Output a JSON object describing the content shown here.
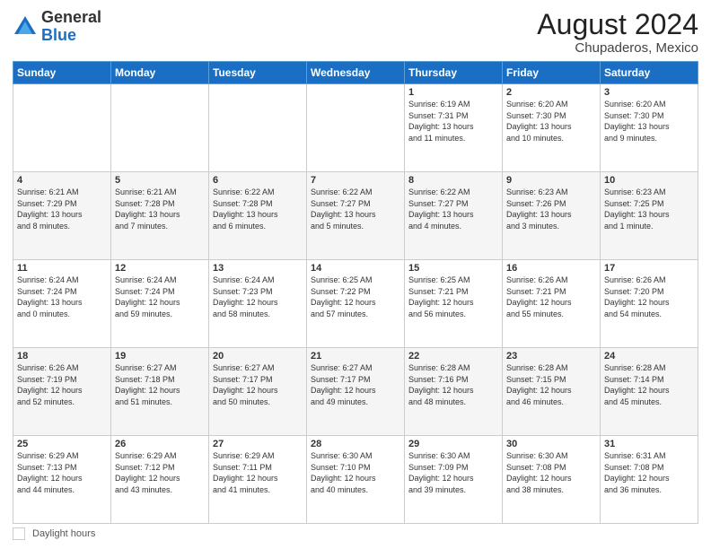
{
  "logo": {
    "general": "General",
    "blue": "Blue"
  },
  "header": {
    "month_year": "August 2024",
    "location": "Chupaderos, Mexico"
  },
  "days_of_week": [
    "Sunday",
    "Monday",
    "Tuesday",
    "Wednesday",
    "Thursday",
    "Friday",
    "Saturday"
  ],
  "weeks": [
    [
      {
        "day": "",
        "info": ""
      },
      {
        "day": "",
        "info": ""
      },
      {
        "day": "",
        "info": ""
      },
      {
        "day": "",
        "info": ""
      },
      {
        "day": "1",
        "info": "Sunrise: 6:19 AM\nSunset: 7:31 PM\nDaylight: 13 hours\nand 11 minutes."
      },
      {
        "day": "2",
        "info": "Sunrise: 6:20 AM\nSunset: 7:30 PM\nDaylight: 13 hours\nand 10 minutes."
      },
      {
        "day": "3",
        "info": "Sunrise: 6:20 AM\nSunset: 7:30 PM\nDaylight: 13 hours\nand 9 minutes."
      }
    ],
    [
      {
        "day": "4",
        "info": "Sunrise: 6:21 AM\nSunset: 7:29 PM\nDaylight: 13 hours\nand 8 minutes."
      },
      {
        "day": "5",
        "info": "Sunrise: 6:21 AM\nSunset: 7:28 PM\nDaylight: 13 hours\nand 7 minutes."
      },
      {
        "day": "6",
        "info": "Sunrise: 6:22 AM\nSunset: 7:28 PM\nDaylight: 13 hours\nand 6 minutes."
      },
      {
        "day": "7",
        "info": "Sunrise: 6:22 AM\nSunset: 7:27 PM\nDaylight: 13 hours\nand 5 minutes."
      },
      {
        "day": "8",
        "info": "Sunrise: 6:22 AM\nSunset: 7:27 PM\nDaylight: 13 hours\nand 4 minutes."
      },
      {
        "day": "9",
        "info": "Sunrise: 6:23 AM\nSunset: 7:26 PM\nDaylight: 13 hours\nand 3 minutes."
      },
      {
        "day": "10",
        "info": "Sunrise: 6:23 AM\nSunset: 7:25 PM\nDaylight: 13 hours\nand 1 minute."
      }
    ],
    [
      {
        "day": "11",
        "info": "Sunrise: 6:24 AM\nSunset: 7:24 PM\nDaylight: 13 hours\nand 0 minutes."
      },
      {
        "day": "12",
        "info": "Sunrise: 6:24 AM\nSunset: 7:24 PM\nDaylight: 12 hours\nand 59 minutes."
      },
      {
        "day": "13",
        "info": "Sunrise: 6:24 AM\nSunset: 7:23 PM\nDaylight: 12 hours\nand 58 minutes."
      },
      {
        "day": "14",
        "info": "Sunrise: 6:25 AM\nSunset: 7:22 PM\nDaylight: 12 hours\nand 57 minutes."
      },
      {
        "day": "15",
        "info": "Sunrise: 6:25 AM\nSunset: 7:21 PM\nDaylight: 12 hours\nand 56 minutes."
      },
      {
        "day": "16",
        "info": "Sunrise: 6:26 AM\nSunset: 7:21 PM\nDaylight: 12 hours\nand 55 minutes."
      },
      {
        "day": "17",
        "info": "Sunrise: 6:26 AM\nSunset: 7:20 PM\nDaylight: 12 hours\nand 54 minutes."
      }
    ],
    [
      {
        "day": "18",
        "info": "Sunrise: 6:26 AM\nSunset: 7:19 PM\nDaylight: 12 hours\nand 52 minutes."
      },
      {
        "day": "19",
        "info": "Sunrise: 6:27 AM\nSunset: 7:18 PM\nDaylight: 12 hours\nand 51 minutes."
      },
      {
        "day": "20",
        "info": "Sunrise: 6:27 AM\nSunset: 7:17 PM\nDaylight: 12 hours\nand 50 minutes."
      },
      {
        "day": "21",
        "info": "Sunrise: 6:27 AM\nSunset: 7:17 PM\nDaylight: 12 hours\nand 49 minutes."
      },
      {
        "day": "22",
        "info": "Sunrise: 6:28 AM\nSunset: 7:16 PM\nDaylight: 12 hours\nand 48 minutes."
      },
      {
        "day": "23",
        "info": "Sunrise: 6:28 AM\nSunset: 7:15 PM\nDaylight: 12 hours\nand 46 minutes."
      },
      {
        "day": "24",
        "info": "Sunrise: 6:28 AM\nSunset: 7:14 PM\nDaylight: 12 hours\nand 45 minutes."
      }
    ],
    [
      {
        "day": "25",
        "info": "Sunrise: 6:29 AM\nSunset: 7:13 PM\nDaylight: 12 hours\nand 44 minutes."
      },
      {
        "day": "26",
        "info": "Sunrise: 6:29 AM\nSunset: 7:12 PM\nDaylight: 12 hours\nand 43 minutes."
      },
      {
        "day": "27",
        "info": "Sunrise: 6:29 AM\nSunset: 7:11 PM\nDaylight: 12 hours\nand 41 minutes."
      },
      {
        "day": "28",
        "info": "Sunrise: 6:30 AM\nSunset: 7:10 PM\nDaylight: 12 hours\nand 40 minutes."
      },
      {
        "day": "29",
        "info": "Sunrise: 6:30 AM\nSunset: 7:09 PM\nDaylight: 12 hours\nand 39 minutes."
      },
      {
        "day": "30",
        "info": "Sunrise: 6:30 AM\nSunset: 7:08 PM\nDaylight: 12 hours\nand 38 minutes."
      },
      {
        "day": "31",
        "info": "Sunrise: 6:31 AM\nSunset: 7:08 PM\nDaylight: 12 hours\nand 36 minutes."
      }
    ]
  ],
  "footer": {
    "daylight_label": "Daylight hours"
  }
}
